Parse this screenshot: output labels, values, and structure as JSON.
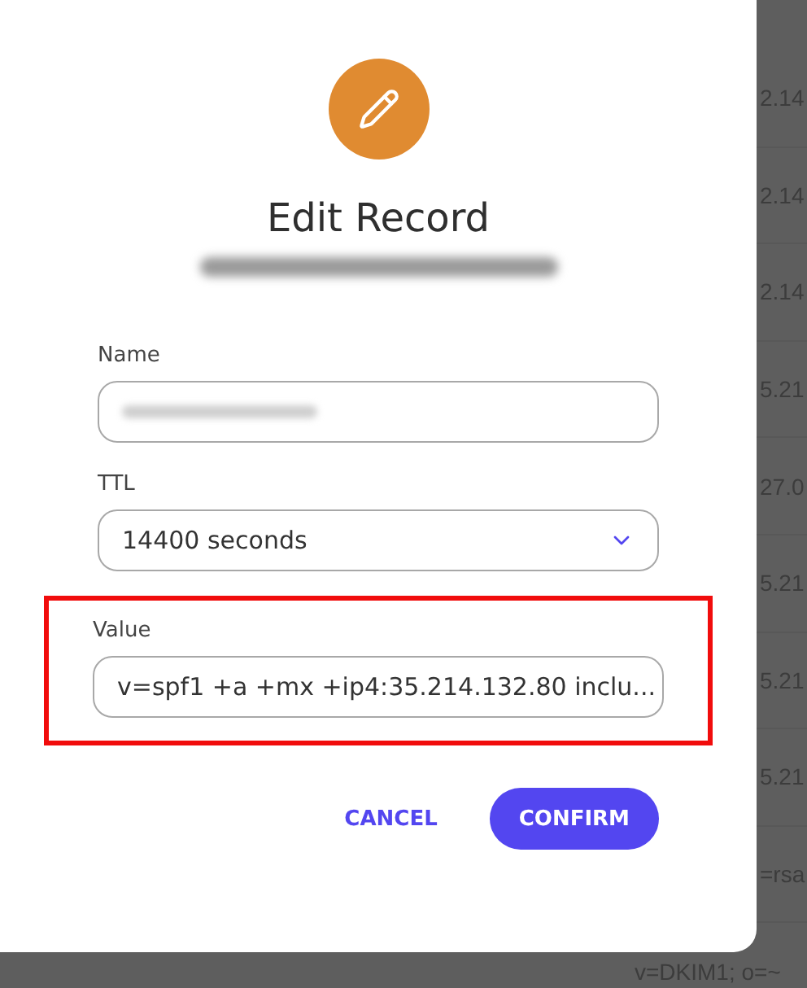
{
  "background_rows": [
    "2.14",
    "2.14",
    "2.14",
    "5.21",
    "27.0",
    "5.21",
    "5.21",
    "5.21",
    "=rsa"
  ],
  "background_last_row": "v=DKIM1; o=~",
  "dialog": {
    "title": "Edit Record",
    "fields": [
      {
        "label": "Name",
        "kind": "text",
        "redacted": true,
        "highlighted": false
      },
      {
        "label": "TTL",
        "kind": "select",
        "value": "14400 seconds",
        "redacted": false,
        "highlighted": false
      },
      {
        "label": "Value",
        "kind": "text",
        "value": "v=spf1 +a +mx +ip4:35.214.132.80 inclu...",
        "redacted": false,
        "highlighted": true
      }
    ],
    "buttons": [
      {
        "label": "CANCEL",
        "kind": "text"
      },
      {
        "label": "CONFIRM",
        "kind": "primary"
      }
    ]
  }
}
